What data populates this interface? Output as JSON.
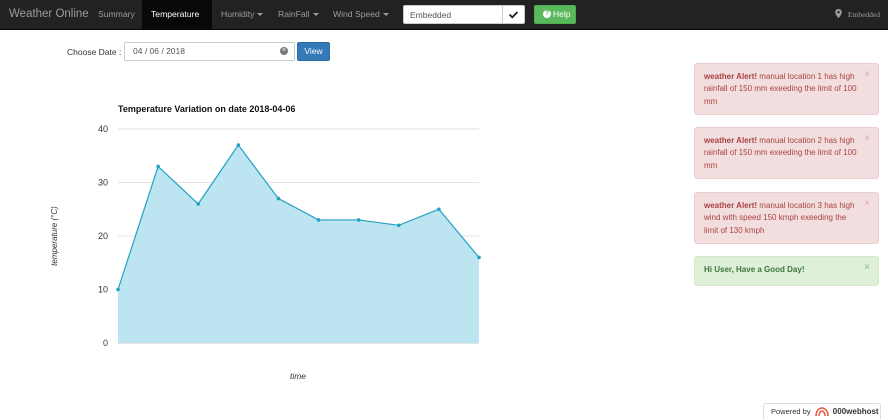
{
  "navbar": {
    "brand": "Weather Online",
    "items": [
      {
        "label": "Summary"
      },
      {
        "label": "Temperature"
      },
      {
        "label": "Humidity"
      },
      {
        "label": "RainFall"
      },
      {
        "label": "Wind Speed"
      }
    ],
    "search_value": "Embedded",
    "help_label": "Help",
    "right_label": "Embedded"
  },
  "date_picker": {
    "label": "Choose Date :",
    "value": "04 / 06 / 2018",
    "view_label": "View"
  },
  "chart_data": {
    "type": "area",
    "title": "Temperature Variation on date 2018-04-06",
    "xlabel": "time",
    "ylabel": "temperature (°C)",
    "y_ticks": [
      0,
      10,
      20,
      30,
      40
    ],
    "ylim": [
      0,
      40
    ],
    "values": [
      10,
      33,
      26,
      37,
      27,
      23,
      23,
      22,
      25,
      16
    ],
    "grid": true,
    "fill_color": "#bce4f1",
    "line_color": "#24a0c4"
  },
  "alerts": [
    {
      "type": "danger",
      "title": "weather Alert!",
      "message": " manual location 1 has high rainfall of 150 mm exeeding the limit of 100 mm"
    },
    {
      "type": "danger",
      "title": "weather Alert!",
      "message": " manual location 2 has high rainfall of 150 mm exeeding the limit of 100 mm"
    },
    {
      "type": "danger",
      "title": "weather Alert!",
      "message": " manual location 3 has high wind with speed 150 kmph exeeding the limit of 130 kmph"
    },
    {
      "type": "success",
      "title": "",
      "message": "Hi User, Have a Good Day!"
    }
  ],
  "alert_close_symbol": "×",
  "footer": {
    "powered_label": "Powered by",
    "host_label": "000webhost"
  },
  "colors": {
    "navbar_bg": "#222222",
    "accent_blue": "#337ab7",
    "help_green": "#5cb85c"
  }
}
